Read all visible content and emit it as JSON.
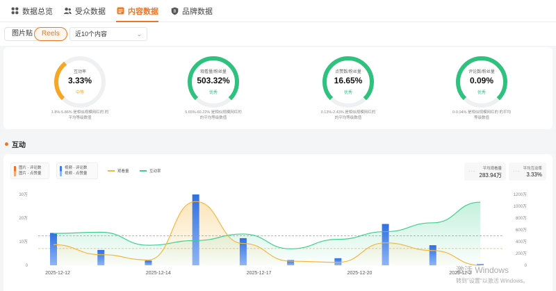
{
  "tabs": [
    {
      "label": "数据总览",
      "icon": "grid-icon"
    },
    {
      "label": "受众数据",
      "icon": "users-icon"
    },
    {
      "label": "内容数据",
      "icon": "content-icon",
      "active": true
    },
    {
      "label": "品牌数据",
      "icon": "brand-icon"
    }
  ],
  "filter": {
    "types": [
      "图片贴",
      "Reels"
    ],
    "active_type": "Reels",
    "range_value": "近10个内容",
    "chevron": "⌄"
  },
  "kpis": [
    {
      "label": "互动率",
      "value": "3.33%",
      "level": "中等",
      "level_color": "#f5a623",
      "color": "#f5a623",
      "fraction": 0.36,
      "note": [
        "1.8%-5.86% 是相似规模网红的 的",
        "平均等级数值"
      ]
    },
    {
      "label": "观看量/粉丝量",
      "value": "503.32%",
      "level": "优秀",
      "level_color": "#2ec27e",
      "color": "#2ec27e",
      "fraction": 1.0,
      "note": [
        "5.65%-60.22% 是相似规模网红的",
        "的平均等级数值"
      ]
    },
    {
      "label": "点赞数/粉丝量",
      "value": "16.65%",
      "level": "优秀",
      "level_color": "#2ec27e",
      "color": "#2ec27e",
      "fraction": 1.0,
      "note": [
        "0.13%-2.43% 是相似规模网红的",
        "的平均等级数值"
      ]
    },
    {
      "label": "评论数/粉丝量",
      "value": "0.09%",
      "level": "优秀",
      "level_color": "#2ec27e",
      "color": "#2ec27e",
      "fraction": 1.0,
      "note": [
        "0-0.04% 是相似规模网红的 的平均",
        "等级数值"
      ]
    }
  ],
  "section_title": "互动",
  "legend": {
    "image_group": [
      "图片 - 评论数",
      "图片 - 点赞量"
    ],
    "video_group": [
      "视频 - 评论数",
      "视频 - 点赞量"
    ],
    "views": "观看量",
    "rate": "互动率",
    "colors": {
      "image": "#f07522",
      "video": "#3b7be8",
      "views": "#f5b63f",
      "rate": "#3ecf8e"
    }
  },
  "averages": [
    {
      "label": "平均观看量",
      "value": "283.94万",
      "placeholder": "- - -"
    },
    {
      "label": "平均互动率",
      "value": "3.33%",
      "placeholder": "- - -"
    }
  ],
  "chart_data": {
    "type": "bar",
    "categories": [
      "2025-12-12",
      "",
      "2025-12-14",
      "",
      "",
      "2025-12-17",
      "",
      "",
      "2025-12-20",
      "",
      "",
      "2025-12-23"
    ],
    "x_tick_labels": [
      "2025-12-12",
      "2025-12-14",
      "2025-12-17",
      "2025-12-20",
      "2025-12-23"
    ],
    "x_tick_labels_shown": [
      "2025-12-12",
      "2025-12-14",
      "2025-12-17",
      "2025-12-20",
      "2025-12-2"
    ],
    "left_axis_ticks": [
      "0",
      "10万",
      "20万",
      "30万"
    ],
    "right_axis_ticks": [
      "0",
      "200万",
      "400万",
      "600万",
      "800万",
      "1000万",
      "1200万"
    ],
    "left_ylim": [
      0,
      300000
    ],
    "right_ylim": [
      0,
      12000000
    ],
    "series": [
      {
        "name": "视频 - 点赞量",
        "axis": "left",
        "values": [
          137000,
          65000,
          20000,
          300000,
          115000,
          22000,
          30000,
          175000,
          85000,
          5000
        ]
      },
      {
        "name": "观看量",
        "axis": "right",
        "values": [
          3500000,
          1800000,
          900000,
          10800000,
          3700000,
          700000,
          500000,
          3800000,
          2500000,
          0
        ]
      },
      {
        "name": "互动率",
        "axis": "right",
        "values": [
          5400000,
          5600000,
          3400000,
          4200000,
          5300000,
          2800000,
          4400000,
          5700000,
          7200000,
          10700000
        ]
      }
    ],
    "reference_lines": [
      {
        "name": "平均观看量",
        "axis": "right",
        "value": 2839400
      },
      {
        "name": "平均互动率",
        "axis": "right",
        "value": 5000000
      }
    ],
    "legend_placement": "top-left"
  },
  "watermark": [
    "激活 Windows",
    "转到\"设置\"以激活 Windows。"
  ]
}
